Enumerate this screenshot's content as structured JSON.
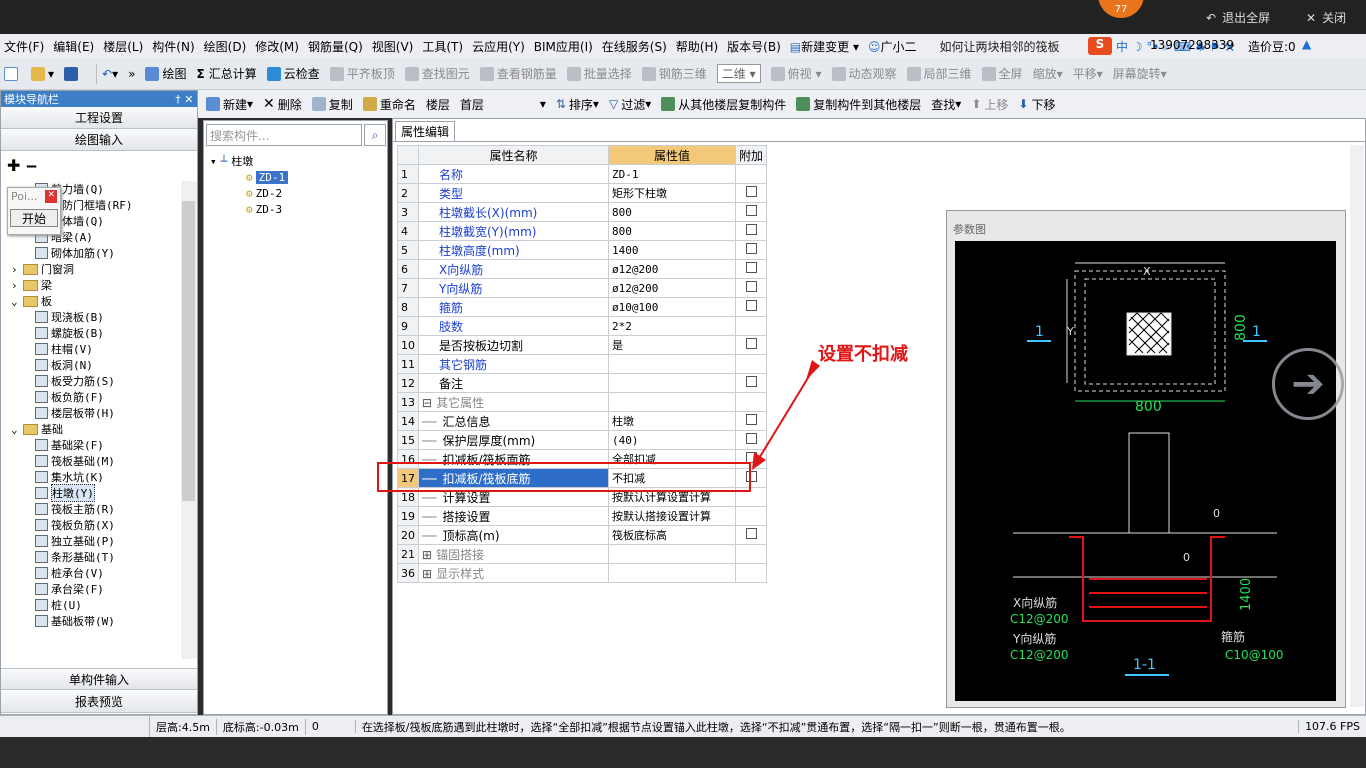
{
  "top": {
    "badge": "77",
    "fullscreen": "退出全屏",
    "close": "关闭"
  },
  "menu": [
    "文件(F)",
    "编辑(E)",
    "楼层(L)",
    "构件(N)",
    "绘图(D)",
    "修改(M)",
    "钢筋量(Q)",
    "视图(V)",
    "工具(T)",
    "云应用(Y)",
    "BIM应用(I)",
    "在线服务(S)",
    "帮助(H)",
    "版本号(B)",
    "新建变更",
    "广小二"
  ],
  "menu_right": {
    "question": "如何让两块相邻的筏板",
    "phone": "13907298339",
    "coins": "造价豆:0"
  },
  "toolbar1": [
    "绘图",
    "汇总计算",
    "云检查",
    "平齐板顶",
    "查找图元",
    "查看钢筋量",
    "批量选择",
    "钢筋三维",
    "二维",
    "俯视",
    "动态观察",
    "局部三维",
    "全屏",
    "缩放",
    "平移",
    "屏幕旋转"
  ],
  "left": {
    "title": "模块导航栏",
    "btn1": "工程设置",
    "btn2": "绘图输入",
    "popup_text": "Poi...",
    "popup_btn": "开始",
    "btn3": "单构件输入",
    "btn4": "报表预览",
    "tree": [
      {
        "indent": 2,
        "label": "剪力墙(Q)",
        "type": "item"
      },
      {
        "indent": 2,
        "label": "人防门框墙(RF)",
        "type": "item"
      },
      {
        "indent": 2,
        "label": "砌体墙(Q)",
        "type": "item"
      },
      {
        "indent": 2,
        "label": "暗梁(A)",
        "type": "item"
      },
      {
        "indent": 2,
        "label": "砌体加筋(Y)",
        "type": "item"
      },
      {
        "indent": 0,
        "label": "门窗洞",
        "type": "folder",
        "exp": "+"
      },
      {
        "indent": 0,
        "label": "梁",
        "type": "folder",
        "exp": "+"
      },
      {
        "indent": 0,
        "label": "板",
        "type": "folder",
        "exp": "-"
      },
      {
        "indent": 2,
        "label": "现浇板(B)",
        "type": "item"
      },
      {
        "indent": 2,
        "label": "螺旋板(B)",
        "type": "item"
      },
      {
        "indent": 2,
        "label": "柱帽(V)",
        "type": "item"
      },
      {
        "indent": 2,
        "label": "板洞(N)",
        "type": "item"
      },
      {
        "indent": 2,
        "label": "板受力筋(S)",
        "type": "item"
      },
      {
        "indent": 2,
        "label": "板负筋(F)",
        "type": "item"
      },
      {
        "indent": 2,
        "label": "楼层板带(H)",
        "type": "item"
      },
      {
        "indent": 0,
        "label": "基础",
        "type": "folder",
        "exp": "-"
      },
      {
        "indent": 2,
        "label": "基础梁(F)",
        "type": "item"
      },
      {
        "indent": 2,
        "label": "筏板基础(M)",
        "type": "item"
      },
      {
        "indent": 2,
        "label": "集水坑(K)",
        "type": "item"
      },
      {
        "indent": 2,
        "label": "柱墩(Y)",
        "type": "item",
        "sel": true
      },
      {
        "indent": 2,
        "label": "筏板主筋(R)",
        "type": "item"
      },
      {
        "indent": 2,
        "label": "筏板负筋(X)",
        "type": "item"
      },
      {
        "indent": 2,
        "label": "独立基础(P)",
        "type": "item"
      },
      {
        "indent": 2,
        "label": "条形基础(T)",
        "type": "item"
      },
      {
        "indent": 2,
        "label": "桩承台(V)",
        "type": "item"
      },
      {
        "indent": 2,
        "label": "承台梁(F)",
        "type": "item"
      },
      {
        "indent": 2,
        "label": "桩(U)",
        "type": "item"
      },
      {
        "indent": 2,
        "label": "基础板带(W)",
        "type": "item"
      }
    ]
  },
  "toolbar2": {
    "new": "新建",
    "delete": "删除",
    "copy": "复制",
    "rename": "重命名",
    "floor_label": "楼层",
    "floor_value": "首层",
    "sort": "排序",
    "filter": "过滤",
    "copy_from": "从其他楼层复制构件",
    "copy_to": "复制构件到其他楼层",
    "find": "查找",
    "up": "上移",
    "down": "下移"
  },
  "mid": {
    "search_placeholder": "搜索构件...",
    "root": "柱墩",
    "items": [
      "ZD-1",
      "ZD-2",
      "ZD-3"
    ]
  },
  "props": {
    "tab": "属性编辑",
    "headers": [
      "属性名称",
      "属性值",
      "附加"
    ],
    "rows": [
      {
        "n": "1",
        "name": "名称",
        "val": "ZD-1",
        "cls": "blue",
        "cb": false
      },
      {
        "n": "2",
        "name": "类型",
        "val": "矩形下柱墩",
        "cls": "blue",
        "cb": true
      },
      {
        "n": "3",
        "name": "柱墩截长(X)(mm)",
        "val": "800",
        "cls": "blue",
        "cb": true
      },
      {
        "n": "4",
        "name": "柱墩截宽(Y)(mm)",
        "val": "800",
        "cls": "blue",
        "cb": true
      },
      {
        "n": "5",
        "name": "柱墩高度(mm)",
        "val": "1400",
        "cls": "blue",
        "cb": true
      },
      {
        "n": "6",
        "name": "X向纵筋",
        "val": "ø12@200",
        "cls": "blue",
        "cb": true
      },
      {
        "n": "7",
        "name": "Y向纵筋",
        "val": "ø12@200",
        "cls": "blue",
        "cb": true
      },
      {
        "n": "8",
        "name": "箍筋",
        "val": "ø10@100",
        "cls": "blue",
        "cb": true
      },
      {
        "n": "9",
        "name": "肢数",
        "val": "2*2",
        "cls": "blue",
        "cb": false
      },
      {
        "n": "10",
        "name": "是否按板边切割",
        "val": "是",
        "cls": "",
        "cb": true
      },
      {
        "n": "11",
        "name": "其它钢筋",
        "val": "",
        "cls": "blue",
        "cb": false
      },
      {
        "n": "12",
        "name": "备注",
        "val": "",
        "cls": "",
        "cb": true
      },
      {
        "n": "13",
        "name": "其它属性",
        "val": "",
        "cls": "gray",
        "grp": "-",
        "cb": false
      },
      {
        "n": "14",
        "name": "汇总信息",
        "val": "柱墩",
        "cls": "",
        "sub": true,
        "cb": true
      },
      {
        "n": "15",
        "name": "保护层厚度(mm)",
        "val": "(40)",
        "cls": "",
        "sub": true,
        "cb": true
      },
      {
        "n": "16",
        "name": "扣减板/筏板面筋",
        "val": "全部扣减",
        "cls": "",
        "sub": true,
        "cb": true
      },
      {
        "n": "17",
        "name": "扣减板/筏板底筋",
        "val": "不扣减",
        "cls": "",
        "sub": true,
        "sel": true,
        "cb": true
      },
      {
        "n": "18",
        "name": "计算设置",
        "val": "按默认计算设置计算",
        "cls": "",
        "sub": true,
        "cb": false
      },
      {
        "n": "19",
        "name": "搭接设置",
        "val": "按默认搭接设置计算",
        "cls": "",
        "sub": true,
        "cb": false
      },
      {
        "n": "20",
        "name": "顶标高(m)",
        "val": "筏板底标高",
        "cls": "",
        "sub": true,
        "cb": true
      },
      {
        "n": "21",
        "name": "锚固搭接",
        "val": "",
        "cls": "gray",
        "grp": "+",
        "cb": false
      },
      {
        "n": "36",
        "name": "显示样式",
        "val": "",
        "cls": "gray",
        "grp": "+",
        "cb": false
      }
    ]
  },
  "annotation": "设置不扣减",
  "diagram": {
    "title": "参数图",
    "x": "X",
    "y": "Y",
    "dim_w": "800",
    "dim_h": "800",
    "sec": "1",
    "zero": "0",
    "h": "1400",
    "xbar": "X向纵筋",
    "xbar_v": "C12@200",
    "ybar": "Y向纵筋",
    "ybar_v": "C12@200",
    "stir": "箍筋",
    "stir_v": "C10@100",
    "cut": "1-1"
  },
  "status": {
    "floor_h": "层高:4.5m",
    "bottom": "底标高:-0.03m",
    "zero": "0",
    "msg": "在选择板/筏板底筋遇到此柱墩时，选择“全部扣减”根据节点设置锚入此柱墩，选择“不扣减”贯通布置，选择“隔一扣一”则断一根，贯通布置一根。",
    "fps": "107.6 FPS"
  }
}
